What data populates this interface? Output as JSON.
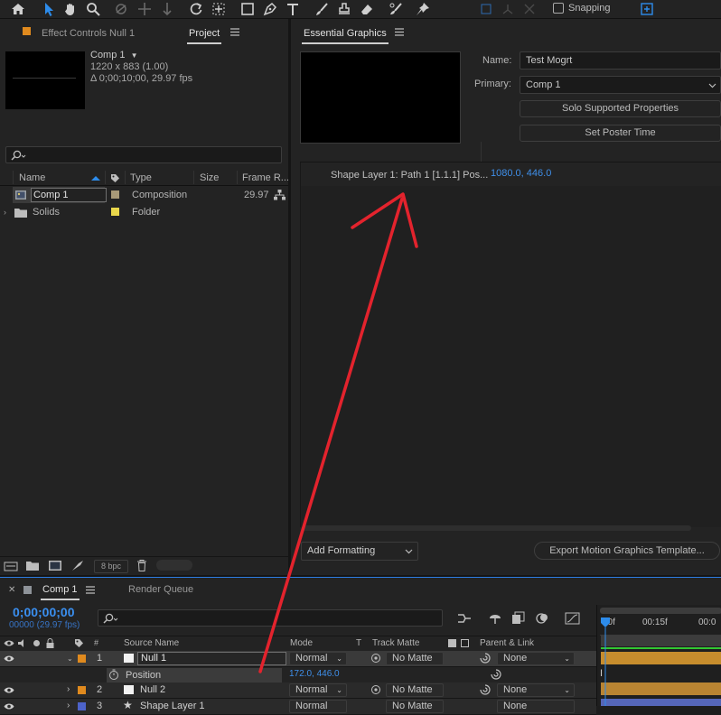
{
  "toolbar": {
    "snapping_label": "Snapping"
  },
  "project_panel": {
    "tabs": {
      "effect_controls": "Effect Controls Null 1",
      "project": "Project"
    },
    "preview": {
      "name": "Comp 1",
      "dims": "1220 x 883 (1.00)",
      "duration": "Δ 0;00;10;00, 29.97 fps"
    },
    "search_placeholder": "",
    "columns": {
      "name": "Name",
      "type": "Type",
      "size": "Size",
      "frame_rate": "Frame R..."
    },
    "items": [
      {
        "name": "Comp 1",
        "type": "Composition",
        "frame_rate": "29.97",
        "label_color": "#a89978"
      },
      {
        "name": "Solids",
        "type": "Folder",
        "frame_rate": "",
        "label_color": "#e9d74b"
      }
    ],
    "bpc": "8 bpc"
  },
  "essential_graphics": {
    "title": "Essential Graphics",
    "name_label": "Name:",
    "name_value": "Test Mogrt",
    "primary_label": "Primary:",
    "primary_value": "Comp 1",
    "solo_button": "Solo Supported Properties",
    "poster_button": "Set Poster Time",
    "property_name": "Shape Layer 1: Path 1 [1.1.1] Pos...",
    "property_x": "1080.0",
    "property_y": "446.0",
    "add_formatting": "Add Formatting",
    "export_button": "Export Motion Graphics Template..."
  },
  "timeline": {
    "tabs": {
      "comp": "Comp 1",
      "render_queue": "Render Queue"
    },
    "timecode": "0;00;00;00",
    "frame_info": "00000 (29.97 fps)",
    "columns": {
      "num": "#",
      "source_name": "Source Name",
      "mode": "Mode",
      "t": "T",
      "track_matte": "Track Matte",
      "parent": "Parent & Link"
    },
    "ruler": [
      "00f",
      "00:15f",
      "00:0"
    ],
    "layers": [
      {
        "num": "1",
        "name": "Null 1",
        "mode": "Normal",
        "matte": "No Matte",
        "parent": "None",
        "color": "#e08a1e",
        "selected": true
      },
      {
        "num": "2",
        "name": "Null 2",
        "mode": "Normal",
        "matte": "No Matte",
        "parent": "None",
        "color": "#e08a1e",
        "selected": false
      },
      {
        "num": "3",
        "name": "Shape Layer 1",
        "mode": "Normal",
        "matte": "No Matte",
        "parent": "None",
        "color": "#4d63c9",
        "selected": false
      }
    ],
    "property": {
      "name": "Position",
      "x": "172.0",
      "y": "446.0"
    }
  },
  "colors": {
    "accent_blue": "#2d8ceb",
    "annotation_red": "#e3232d",
    "null_bar": "#c78d2d",
    "shape_bar": "#5566b8"
  }
}
